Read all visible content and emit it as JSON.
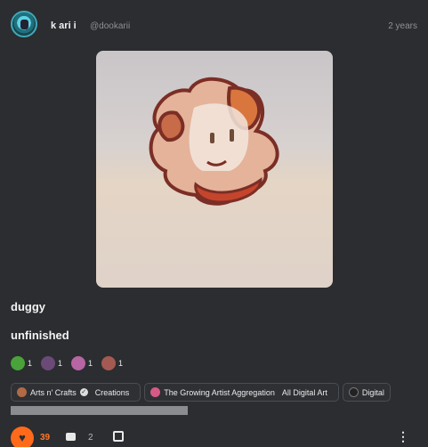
{
  "post": {
    "username": "k ari i",
    "handle": "@dookarii",
    "timestamp": "2 years",
    "title": "duggy",
    "body": "unfinished"
  },
  "reactions": [
    {
      "icon": "green-emoji-icon",
      "count": "1",
      "color": "#4aa23a"
    },
    {
      "icon": "purple-emoji-icon",
      "count": "1",
      "color": "#6b4a78"
    },
    {
      "icon": "pink-emoji-icon",
      "count": "1",
      "color": "#b765a3"
    },
    {
      "icon": "cat-emoji-icon",
      "count": "1",
      "color": "#a45a52"
    }
  ],
  "tags": [
    {
      "community": "Arts n' Crafts",
      "channel": "Creations",
      "icon_color": "#b06a46"
    },
    {
      "community": "The Growing Artist Aggregation",
      "channel": "All Digital Art",
      "icon_color": "#d75a86"
    },
    {
      "community": "Digital",
      "channel": "",
      "icon_color": "#222"
    }
  ],
  "actions": {
    "like_count": "39",
    "comment_count": "2",
    "like_symbol": "♥",
    "more_symbol": "⋮"
  },
  "colors": {
    "background": "#2b2d30",
    "accent": "#ff6a1a"
  }
}
